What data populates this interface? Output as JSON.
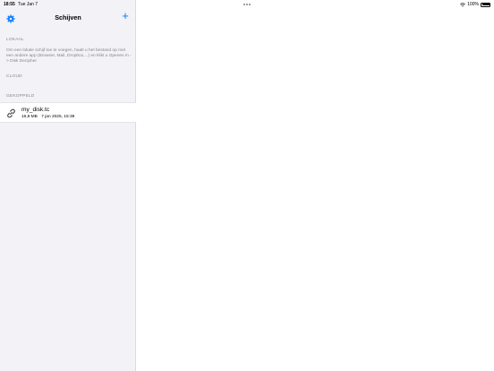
{
  "status_bar": {
    "time": "18:55",
    "date": "Tue Jan 7",
    "battery": "100%"
  },
  "sidebar": {
    "title": "Schijven",
    "add_label": "+",
    "sections": {
      "lokaal": {
        "header": "LOKAAL",
        "info": "Om een lokale schijf toe te voegen, haalt u het bestand op met een andere app (Browser, Mail, Dropbox,...) en klikt u Openen in -> Disk Decipher"
      },
      "cloud": {
        "header": "CLOUD"
      },
      "gekoppeld": {
        "header": "GEKOPPELD",
        "items": [
          {
            "name": "my_disk.tc",
            "size": "16,8 MB",
            "date": "7 jan 2025, 15:38"
          }
        ]
      }
    }
  },
  "colors": {
    "accent": "#0a7aff",
    "sidebar_bg": "#f2f2f7",
    "secondary_text": "#86868b"
  }
}
